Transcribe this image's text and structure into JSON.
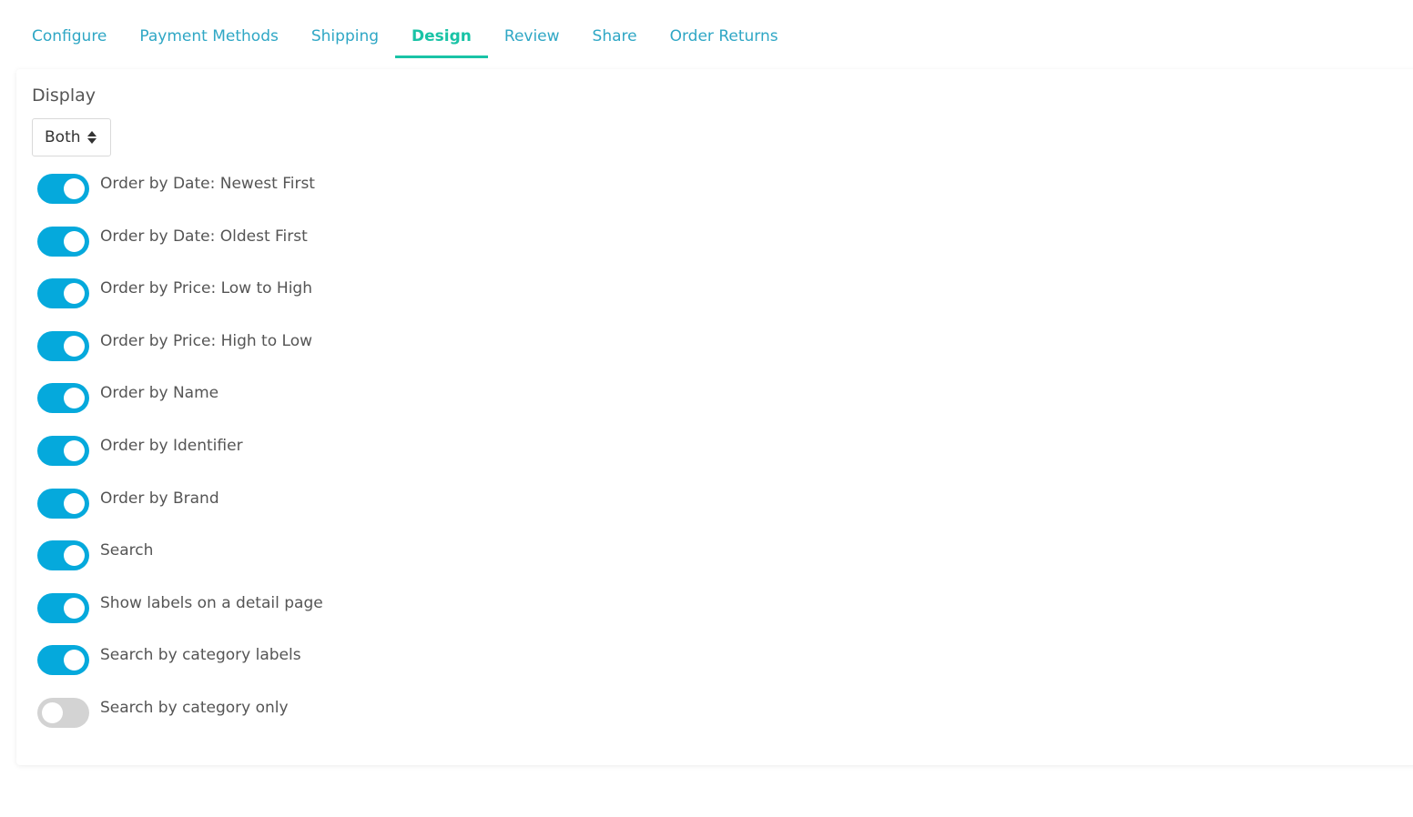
{
  "tabs": [
    {
      "label": "Configure",
      "active": false
    },
    {
      "label": "Payment Methods",
      "active": false
    },
    {
      "label": "Shipping",
      "active": false
    },
    {
      "label": "Design",
      "active": true
    },
    {
      "label": "Review",
      "active": false
    },
    {
      "label": "Share",
      "active": false
    },
    {
      "label": "Order Returns",
      "active": false
    }
  ],
  "display": {
    "title": "Display",
    "select_value": "Both",
    "select_icon": "up-down-arrows-icon"
  },
  "toggles": [
    {
      "label": "Order by Date: Newest First",
      "on": true
    },
    {
      "label": "Order by Date: Oldest First",
      "on": true
    },
    {
      "label": "Order by Price: Low to High",
      "on": true
    },
    {
      "label": "Order by Price: High to Low",
      "on": true
    },
    {
      "label": "Order by Name",
      "on": true
    },
    {
      "label": "Order by Identifier",
      "on": true
    },
    {
      "label": "Order by Brand",
      "on": true
    },
    {
      "label": "Search",
      "on": true
    },
    {
      "label": "Show labels on a detail page",
      "on": true
    },
    {
      "label": "Search by category labels",
      "on": true
    },
    {
      "label": "Search by category only",
      "on": false
    }
  ],
  "colors": {
    "tab_text": "#2fa7c5",
    "tab_active": "#19c3a6",
    "toggle_on": "#05a9dc",
    "toggle_off": "#d3d3d3"
  }
}
